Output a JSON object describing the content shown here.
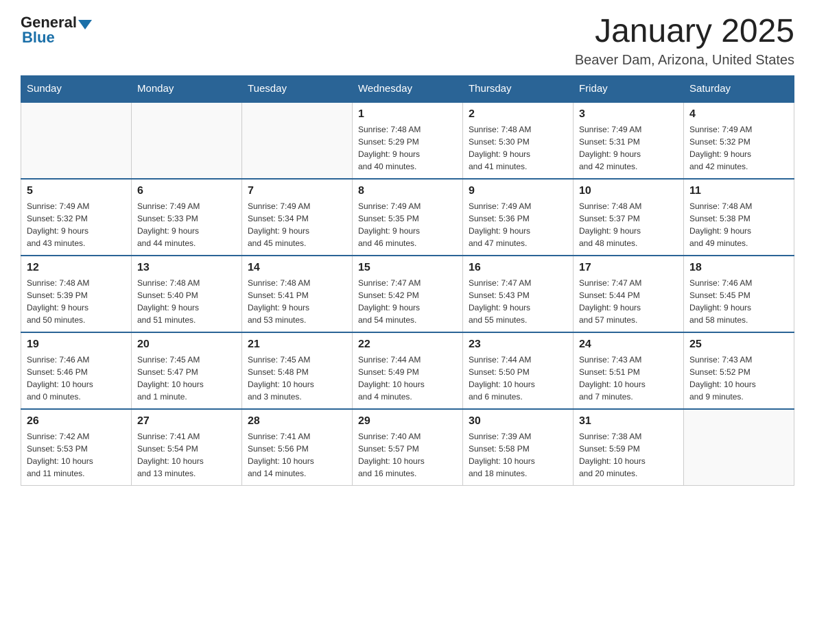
{
  "header": {
    "logo_general": "General",
    "logo_blue": "Blue",
    "month_title": "January 2025",
    "location": "Beaver Dam, Arizona, United States"
  },
  "days_of_week": [
    "Sunday",
    "Monday",
    "Tuesday",
    "Wednesday",
    "Thursday",
    "Friday",
    "Saturday"
  ],
  "weeks": [
    [
      {
        "day": "",
        "info": ""
      },
      {
        "day": "",
        "info": ""
      },
      {
        "day": "",
        "info": ""
      },
      {
        "day": "1",
        "info": "Sunrise: 7:48 AM\nSunset: 5:29 PM\nDaylight: 9 hours\nand 40 minutes."
      },
      {
        "day": "2",
        "info": "Sunrise: 7:48 AM\nSunset: 5:30 PM\nDaylight: 9 hours\nand 41 minutes."
      },
      {
        "day": "3",
        "info": "Sunrise: 7:49 AM\nSunset: 5:31 PM\nDaylight: 9 hours\nand 42 minutes."
      },
      {
        "day": "4",
        "info": "Sunrise: 7:49 AM\nSunset: 5:32 PM\nDaylight: 9 hours\nand 42 minutes."
      }
    ],
    [
      {
        "day": "5",
        "info": "Sunrise: 7:49 AM\nSunset: 5:32 PM\nDaylight: 9 hours\nand 43 minutes."
      },
      {
        "day": "6",
        "info": "Sunrise: 7:49 AM\nSunset: 5:33 PM\nDaylight: 9 hours\nand 44 minutes."
      },
      {
        "day": "7",
        "info": "Sunrise: 7:49 AM\nSunset: 5:34 PM\nDaylight: 9 hours\nand 45 minutes."
      },
      {
        "day": "8",
        "info": "Sunrise: 7:49 AM\nSunset: 5:35 PM\nDaylight: 9 hours\nand 46 minutes."
      },
      {
        "day": "9",
        "info": "Sunrise: 7:49 AM\nSunset: 5:36 PM\nDaylight: 9 hours\nand 47 minutes."
      },
      {
        "day": "10",
        "info": "Sunrise: 7:48 AM\nSunset: 5:37 PM\nDaylight: 9 hours\nand 48 minutes."
      },
      {
        "day": "11",
        "info": "Sunrise: 7:48 AM\nSunset: 5:38 PM\nDaylight: 9 hours\nand 49 minutes."
      }
    ],
    [
      {
        "day": "12",
        "info": "Sunrise: 7:48 AM\nSunset: 5:39 PM\nDaylight: 9 hours\nand 50 minutes."
      },
      {
        "day": "13",
        "info": "Sunrise: 7:48 AM\nSunset: 5:40 PM\nDaylight: 9 hours\nand 51 minutes."
      },
      {
        "day": "14",
        "info": "Sunrise: 7:48 AM\nSunset: 5:41 PM\nDaylight: 9 hours\nand 53 minutes."
      },
      {
        "day": "15",
        "info": "Sunrise: 7:47 AM\nSunset: 5:42 PM\nDaylight: 9 hours\nand 54 minutes."
      },
      {
        "day": "16",
        "info": "Sunrise: 7:47 AM\nSunset: 5:43 PM\nDaylight: 9 hours\nand 55 minutes."
      },
      {
        "day": "17",
        "info": "Sunrise: 7:47 AM\nSunset: 5:44 PM\nDaylight: 9 hours\nand 57 minutes."
      },
      {
        "day": "18",
        "info": "Sunrise: 7:46 AM\nSunset: 5:45 PM\nDaylight: 9 hours\nand 58 minutes."
      }
    ],
    [
      {
        "day": "19",
        "info": "Sunrise: 7:46 AM\nSunset: 5:46 PM\nDaylight: 10 hours\nand 0 minutes."
      },
      {
        "day": "20",
        "info": "Sunrise: 7:45 AM\nSunset: 5:47 PM\nDaylight: 10 hours\nand 1 minute."
      },
      {
        "day": "21",
        "info": "Sunrise: 7:45 AM\nSunset: 5:48 PM\nDaylight: 10 hours\nand 3 minutes."
      },
      {
        "day": "22",
        "info": "Sunrise: 7:44 AM\nSunset: 5:49 PM\nDaylight: 10 hours\nand 4 minutes."
      },
      {
        "day": "23",
        "info": "Sunrise: 7:44 AM\nSunset: 5:50 PM\nDaylight: 10 hours\nand 6 minutes."
      },
      {
        "day": "24",
        "info": "Sunrise: 7:43 AM\nSunset: 5:51 PM\nDaylight: 10 hours\nand 7 minutes."
      },
      {
        "day": "25",
        "info": "Sunrise: 7:43 AM\nSunset: 5:52 PM\nDaylight: 10 hours\nand 9 minutes."
      }
    ],
    [
      {
        "day": "26",
        "info": "Sunrise: 7:42 AM\nSunset: 5:53 PM\nDaylight: 10 hours\nand 11 minutes."
      },
      {
        "day": "27",
        "info": "Sunrise: 7:41 AM\nSunset: 5:54 PM\nDaylight: 10 hours\nand 13 minutes."
      },
      {
        "day": "28",
        "info": "Sunrise: 7:41 AM\nSunset: 5:56 PM\nDaylight: 10 hours\nand 14 minutes."
      },
      {
        "day": "29",
        "info": "Sunrise: 7:40 AM\nSunset: 5:57 PM\nDaylight: 10 hours\nand 16 minutes."
      },
      {
        "day": "30",
        "info": "Sunrise: 7:39 AM\nSunset: 5:58 PM\nDaylight: 10 hours\nand 18 minutes."
      },
      {
        "day": "31",
        "info": "Sunrise: 7:38 AM\nSunset: 5:59 PM\nDaylight: 10 hours\nand 20 minutes."
      },
      {
        "day": "",
        "info": ""
      }
    ]
  ]
}
